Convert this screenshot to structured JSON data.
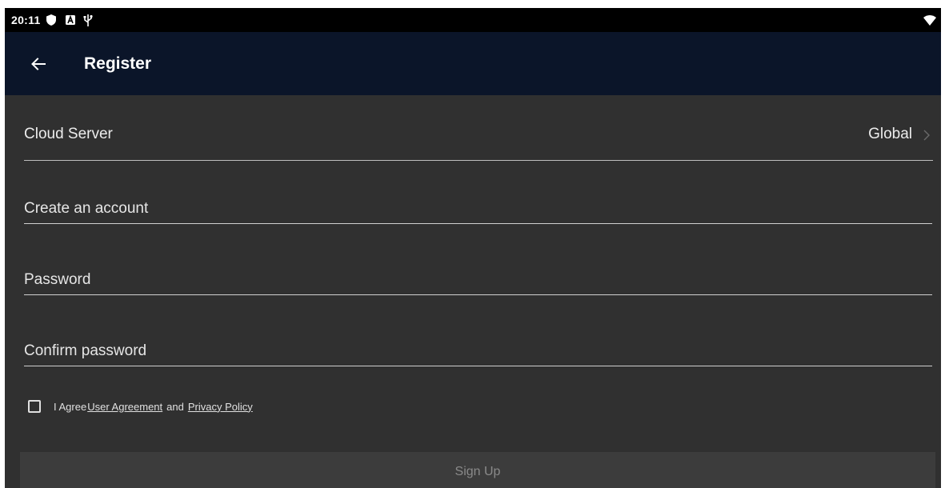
{
  "status_bar": {
    "time": "20:11",
    "icons": [
      "shield-icon",
      "a-badge-icon",
      "usb-icon",
      "wifi-icon"
    ]
  },
  "app_bar": {
    "title": "Register",
    "back_icon": "arrow-left-icon"
  },
  "cloud_server": {
    "label": "Cloud Server",
    "value": "Global",
    "chevron_icon": "chevron-right-icon"
  },
  "fields": {
    "account_placeholder": "Create an account",
    "password_placeholder": "Password",
    "confirm_placeholder": "Confirm password"
  },
  "agreement": {
    "prefix": "I Agree",
    "user_agreement": "User Agreement",
    "conjunction": "and",
    "privacy_policy": "Privacy Policy",
    "checked": false
  },
  "signup": {
    "label": "Sign Up"
  },
  "colors": {
    "status_bar_bg": "#000000",
    "app_bar_bg": "#0b1529",
    "background": "#303030",
    "button_bg": "#3c3c3c",
    "button_text": "#8a8a8a"
  }
}
